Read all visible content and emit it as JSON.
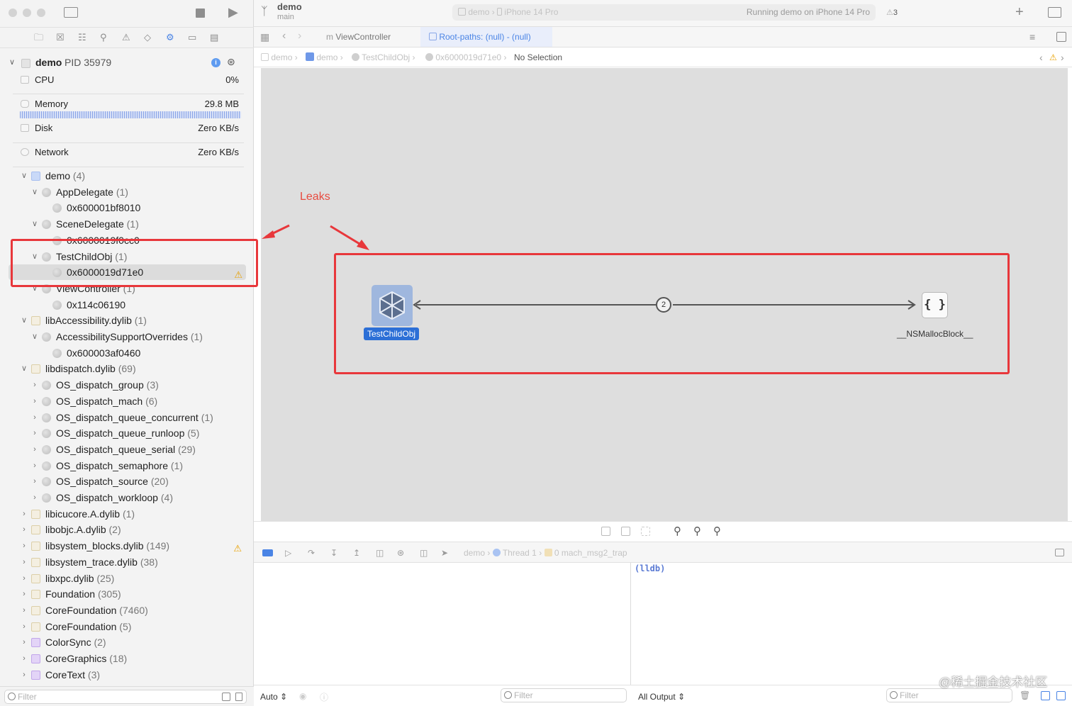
{
  "window": {
    "scheme": "demo",
    "branch": "main",
    "run_destination_app": "demo",
    "run_destination_device": "iPhone 14 Pro",
    "activity_status": "Running demo on iPhone 14 Pro",
    "warning_count": "3"
  },
  "process": {
    "name": "demo",
    "pid_label": "PID 35979"
  },
  "gauges": [
    {
      "label": "CPU",
      "value": "0%"
    },
    {
      "label": "Memory",
      "value": "29.8 MB"
    },
    {
      "label": "Disk",
      "value": "Zero KB/s"
    },
    {
      "label": "Network",
      "value": "Zero KB/s"
    }
  ],
  "tree": [
    {
      "label": "demo",
      "count": "(4)",
      "icon": "user-icon",
      "expanded": true,
      "warn": false
    },
    {
      "label": "AppDelegate",
      "count": "(1)",
      "icon": "object-icon",
      "expanded": true,
      "warn": false
    },
    {
      "label": "0x600001bf8010",
      "count": "",
      "icon": "object-icon",
      "warn": false
    },
    {
      "label": "SceneDelegate",
      "count": "(1)",
      "icon": "object-icon",
      "expanded": true,
      "warn": false
    },
    {
      "label": "0x6000019f0cc0",
      "count": "",
      "icon": "object-icon",
      "warn": false
    },
    {
      "label": "TestChildObj",
      "count": "(1)",
      "icon": "object-icon",
      "expanded": true,
      "warn": false
    },
    {
      "label": "0x6000019d71e0",
      "count": "",
      "icon": "object-icon",
      "warn": true,
      "selected": true
    },
    {
      "label": "ViewController",
      "count": "(1)",
      "icon": "object-icon",
      "expanded": true,
      "warn": false
    },
    {
      "label": "0x114c06190",
      "count": "",
      "icon": "object-icon",
      "warn": false
    },
    {
      "label": "libAccessibility.dylib",
      "count": "(1)",
      "icon": "library-icon",
      "expanded": true,
      "warn": false
    },
    {
      "label": "AccessibilitySupportOverrides",
      "count": "(1)",
      "icon": "object-icon",
      "expanded": true,
      "warn": false
    },
    {
      "label": "0x600003af0460",
      "count": "",
      "icon": "object-icon",
      "warn": false
    },
    {
      "label": "libdispatch.dylib",
      "count": "(69)",
      "icon": "library-icon",
      "expanded": true,
      "warn": false
    },
    {
      "label": "OS_dispatch_group",
      "count": "(3)",
      "icon": "object-icon",
      "expanded": false,
      "warn": false
    },
    {
      "label": "OS_dispatch_mach",
      "count": "(6)",
      "icon": "object-icon",
      "expanded": false,
      "warn": false
    },
    {
      "label": "OS_dispatch_queue_concurrent",
      "count": "(1)",
      "icon": "object-icon",
      "expanded": false,
      "warn": false
    },
    {
      "label": "OS_dispatch_queue_runloop",
      "count": "(5)",
      "icon": "object-icon",
      "expanded": false,
      "warn": false
    },
    {
      "label": "OS_dispatch_queue_serial",
      "count": "(29)",
      "icon": "object-icon",
      "expanded": false,
      "warn": false
    },
    {
      "label": "OS_dispatch_semaphore",
      "count": "(1)",
      "icon": "object-icon",
      "expanded": false,
      "warn": false
    },
    {
      "label": "OS_dispatch_source",
      "count": "(20)",
      "icon": "object-icon",
      "expanded": false,
      "warn": false
    },
    {
      "label": "OS_dispatch_workloop",
      "count": "(4)",
      "icon": "object-icon",
      "expanded": false,
      "warn": false
    },
    {
      "label": "libicucore.A.dylib",
      "count": "(1)",
      "icon": "library-icon",
      "expanded": false,
      "warn": false
    },
    {
      "label": "libobjc.A.dylib",
      "count": "(2)",
      "icon": "library-icon",
      "expanded": false,
      "warn": false
    },
    {
      "label": "libsystem_blocks.dylib",
      "count": "(149)",
      "icon": "library-icon",
      "expanded": false,
      "warn": true
    },
    {
      "label": "libsystem_trace.dylib",
      "count": "(38)",
      "icon": "library-icon",
      "expanded": false,
      "warn": false
    },
    {
      "label": "libxpc.dylib",
      "count": "(25)",
      "icon": "library-icon",
      "expanded": false,
      "warn": false
    },
    {
      "label": "Foundation",
      "count": "(305)",
      "icon": "library-icon",
      "expanded": false,
      "warn": false
    },
    {
      "label": "CoreFoundation",
      "count": "(7460)",
      "icon": "library-icon",
      "expanded": false,
      "warn": false
    },
    {
      "label": "CoreFoundation",
      "count": "(5)",
      "icon": "library-icon",
      "expanded": false,
      "warn": false
    },
    {
      "label": "ColorSync",
      "count": "(2)",
      "icon": "framework-icon",
      "expanded": false,
      "warn": false
    },
    {
      "label": "CoreGraphics",
      "count": "(18)",
      "icon": "framework-icon",
      "expanded": false,
      "warn": false
    },
    {
      "label": "CoreText",
      "count": "(3)",
      "icon": "framework-icon",
      "expanded": false,
      "warn": false
    }
  ],
  "sidebar_filter": {
    "placeholder": "Filter"
  },
  "tabs": [
    {
      "label": "ViewController",
      "prefix": "m"
    },
    {
      "label": "Root-paths: (null) - (null)"
    }
  ],
  "breadcrumb": [
    "demo",
    "demo",
    "TestChildObj",
    "0x6000019d71e0",
    "No Selection"
  ],
  "graph": {
    "annotation": "Leaks",
    "source_node": "TestChildObj",
    "target_node": "__NSMallocBlock__",
    "target_symbol": "{ }",
    "edge_count": "2"
  },
  "debug_bar": {
    "process": "demo",
    "thread": "Thread 1",
    "frame": "0 mach_msg2_trap"
  },
  "console": {
    "prompt": "(lldb)"
  },
  "bottom_bar": {
    "variables_mode": "Auto",
    "variables_filter": "Filter",
    "output_mode": "All Output",
    "console_filter": "Filter"
  },
  "watermark": "@稀土掘金技术社区",
  "colors": {
    "annotation_red": "#e8373b",
    "accent_blue": "#2c6fd6",
    "warning_yellow": "#e8a100"
  }
}
